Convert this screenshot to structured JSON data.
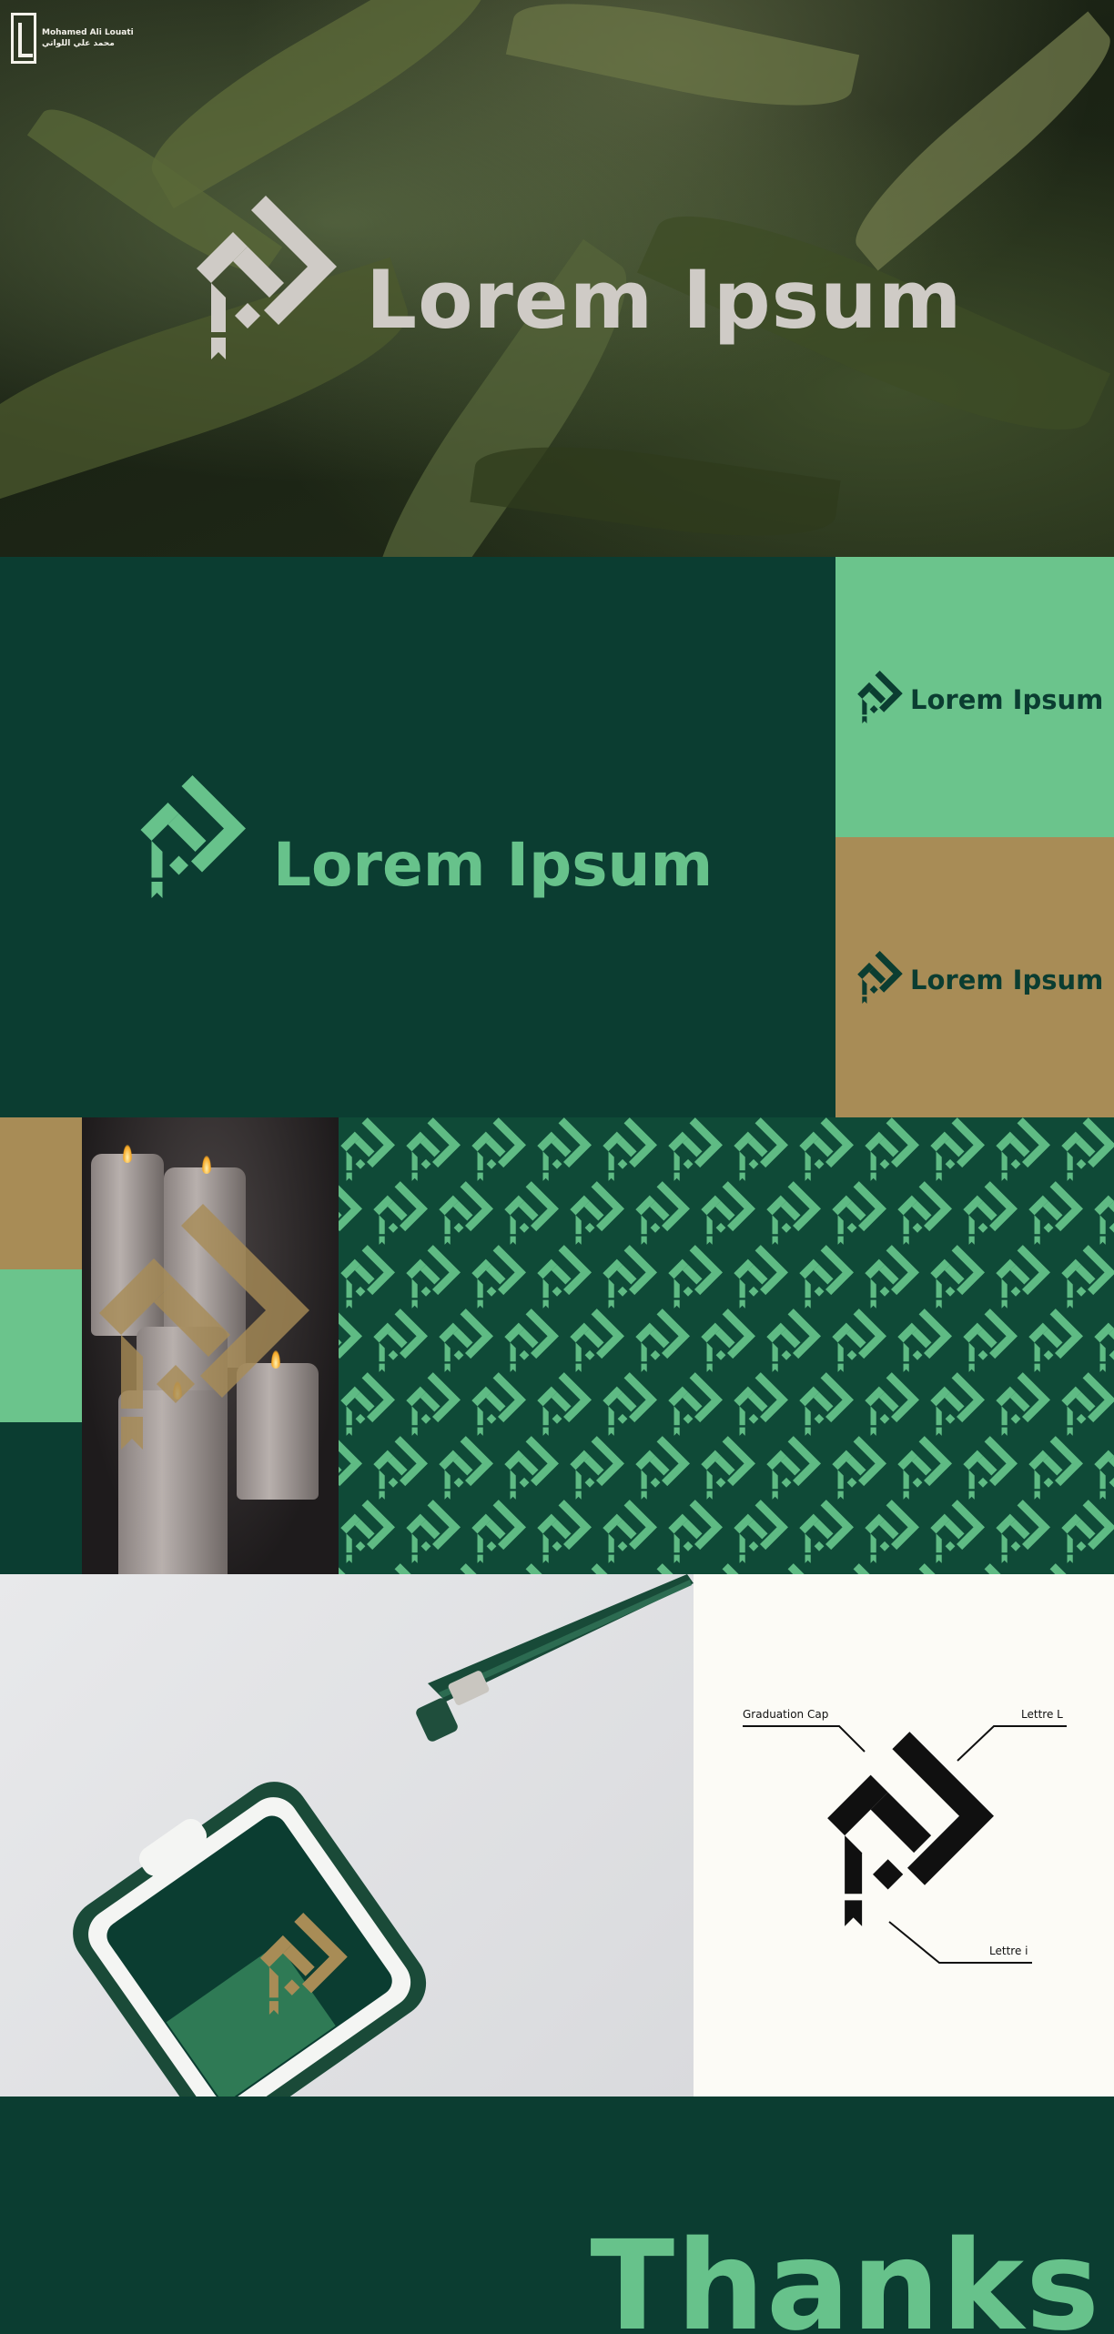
{
  "hero": {
    "signature_name": "Mohamed Ali Louati",
    "signature_arabic": "محمد علي اللواتي",
    "title": "Lorem Ipsum"
  },
  "brand": {
    "title": "Lorem Ipsum",
    "swatch_green_title": "Lorem Ipsum",
    "swatch_gold_title": "Lorem Ipsum"
  },
  "construction": {
    "graduation_cap_label": "Graduation Cap",
    "lettre_l_label": "Lettre L",
    "lettre_i_label": "Lettre i"
  },
  "thanks": {
    "text": "Thanks"
  },
  "colors": {
    "dark_green": "#0b3d31",
    "mint_green": "#6bc48c",
    "gold": "#a88c56",
    "light_grey": "#cfcbc6",
    "cream": "#fcfbf6"
  },
  "icons": [
    "brand-logo-icon",
    "signature-monogram-icon",
    "badge-lanyard-icon",
    "candle-photo"
  ]
}
